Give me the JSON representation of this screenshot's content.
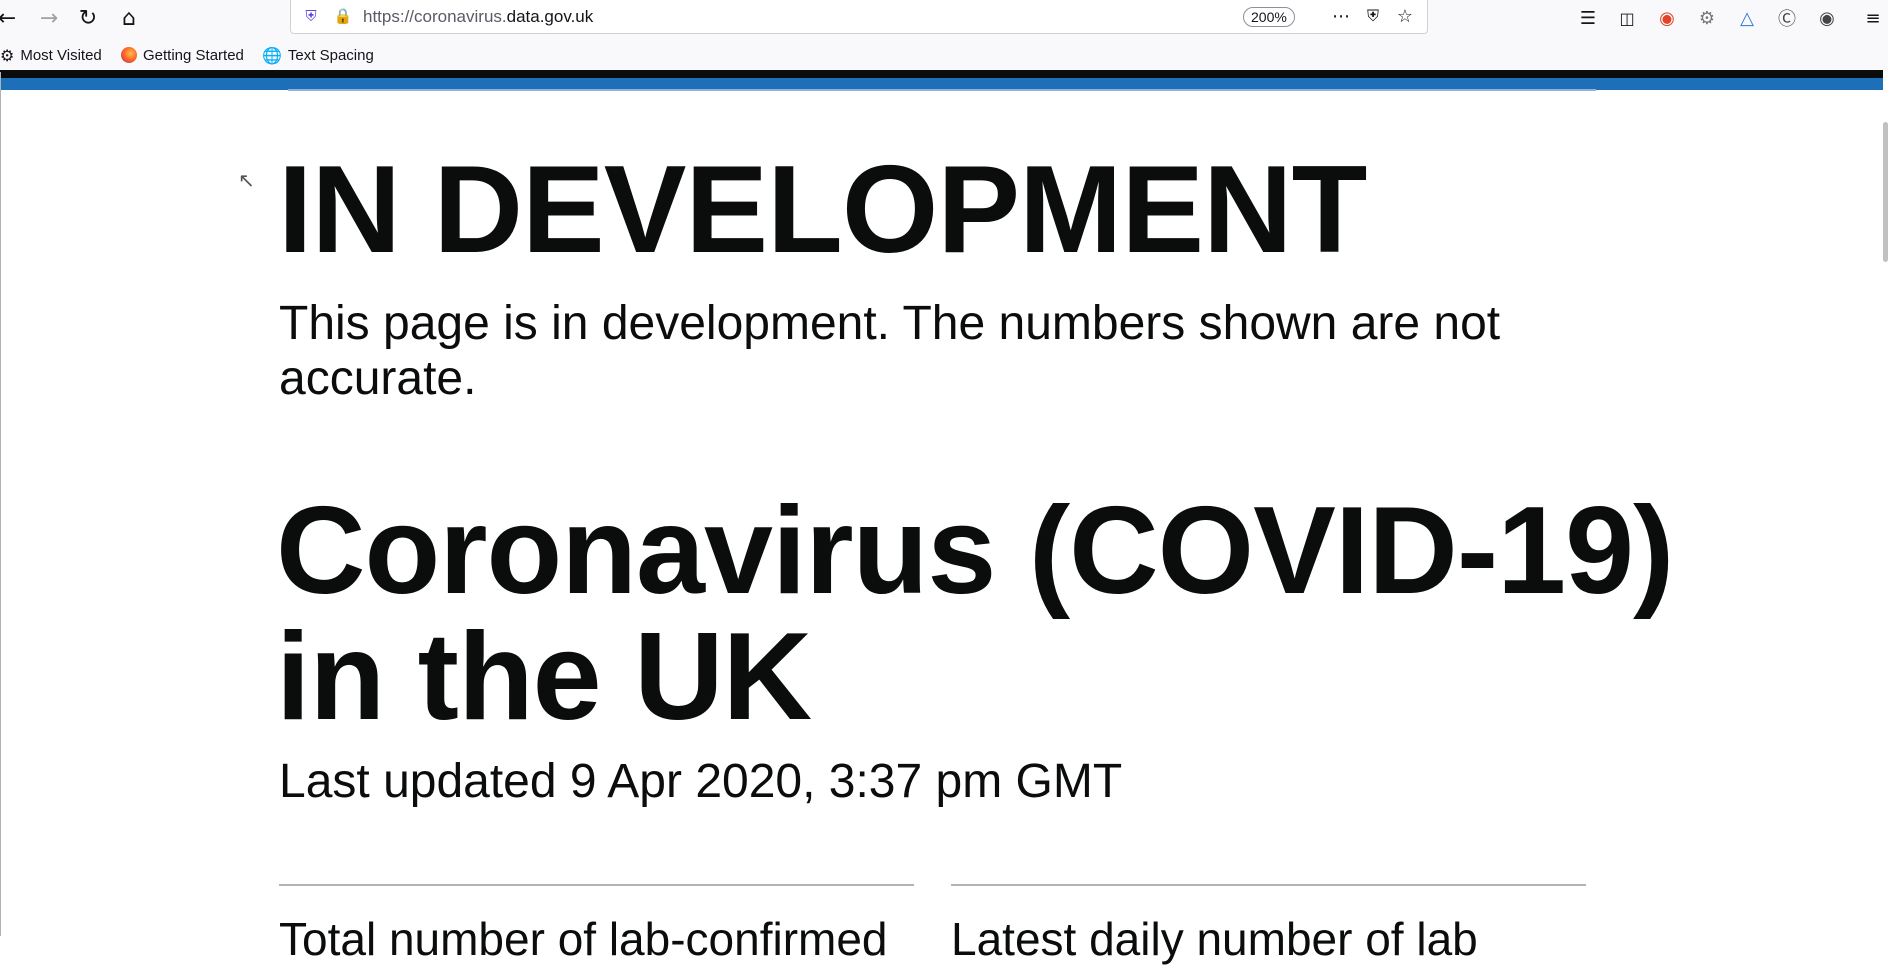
{
  "browser": {
    "url_prefix": "https://coronavirus.",
    "url_domain": "data.gov.uk",
    "zoom": "200%",
    "bookmarks": [
      "Most Visited",
      "Getting Started",
      "Text Spacing"
    ]
  },
  "page": {
    "dev_heading": "IN DEVELOPMENT",
    "dev_text": "This page is in development. The numbers shown are not accurate.",
    "title": "Coronavirus (COVID-19) in the UK",
    "last_updated": "Last updated 9 Apr 2020, 3:37 pm GMT",
    "cards": [
      {
        "label": "Total number of lab-confirmed"
      },
      {
        "label": "Latest daily number of lab"
      }
    ]
  },
  "colors": {
    "accent_blue": "#1d70b8",
    "text": "#0b0c0c"
  },
  "icons": [
    "back-icon",
    "forward-icon",
    "reload-icon",
    "home-icon",
    "tracking-shield-icon",
    "lock-icon",
    "more-icon",
    "pocket-icon",
    "bookmark-star-icon",
    "library-icon",
    "sidebar-icon",
    "extension-icon",
    "menu-icon"
  ]
}
